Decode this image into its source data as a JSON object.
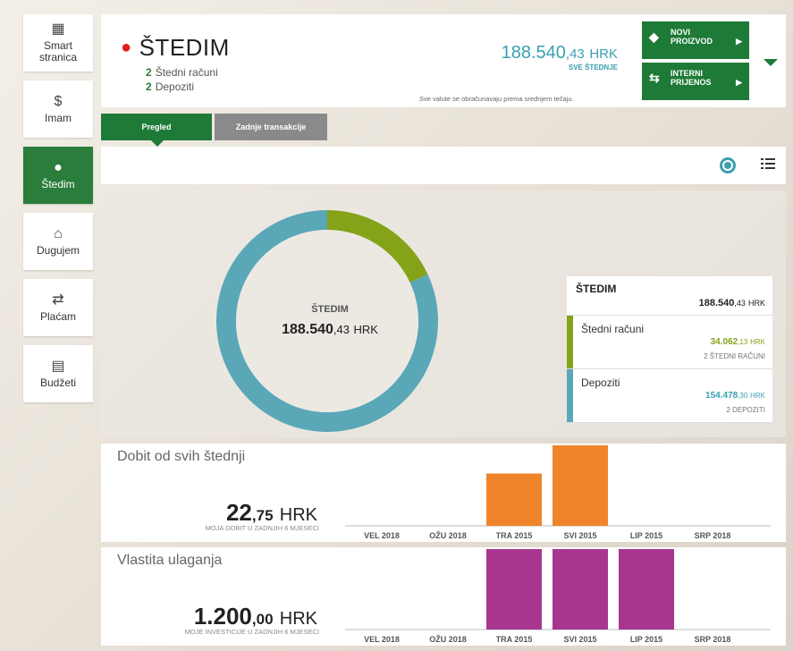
{
  "sidebar": {
    "items": [
      {
        "label": "Smart stranica",
        "icon": "grid-icon"
      },
      {
        "label": "Imam",
        "icon": "money-bag-icon"
      },
      {
        "label": "Štedim",
        "icon": "piggy-bank-icon"
      },
      {
        "label": "Dugujem",
        "icon": "house-debt-icon"
      },
      {
        "label": "Plaćam",
        "icon": "payment-icon"
      },
      {
        "label": "Budžeti",
        "icon": "wallet-icon"
      }
    ]
  },
  "header": {
    "title": "ŠTEDIM",
    "sub1_count": "2",
    "sub1_label": "Štedni računi",
    "sub2_count": "2",
    "sub2_label": "Depoziti",
    "total_int": "188.540",
    "total_dec": ",43",
    "total_cur": "HRK",
    "total_label": "SVE ŠTEDNJE",
    "note": "Sve valute se obračunavaju prema srednjem tečaju.",
    "btn_new_l1": "NOVI",
    "btn_new_l2": "PROIZVOD",
    "btn_transfer_l1": "INTERNI",
    "btn_transfer_l2": "PRIJENOS"
  },
  "tabs": {
    "overview": "Pregled",
    "transactions": "Zadnje transakcije"
  },
  "donut": {
    "center_label": "ŠTEDIM",
    "center_int": "188.540",
    "center_dec": ",43",
    "center_cur": "HRK"
  },
  "legend": {
    "title": "ŠTEDIM",
    "total_int": "188.540",
    "total_dec": ",43",
    "total_cur": "HRK",
    "rows": [
      {
        "name": "Štedni računi",
        "int": "34.062",
        "dec": ",13",
        "cur": "HRK",
        "sub": "2 ŠTEDNI RAČUNI",
        "color": "#84a318"
      },
      {
        "name": "Depoziti",
        "int": "154.478",
        "dec": ",30",
        "cur": "HRK",
        "sub": "2 DEPOZITI",
        "color": "#5aa7b8"
      }
    ]
  },
  "profit": {
    "title": "Dobit od svih štednji",
    "int": "22",
    "dec": ",75",
    "cur": "HRK",
    "sub": "MOJA DOBIT U ZADNJIH 6 MJESECI"
  },
  "investments": {
    "title": "Vlastita ulaganja",
    "int": "1.200",
    "dec": ",00",
    "cur": "HRK",
    "sub": "MOJE INVESTICIJE U ZADNJIH 6 MJESECI"
  },
  "chart_data": [
    {
      "type": "pie",
      "categories": [
        "Štedni računi",
        "Depoziti"
      ],
      "values": [
        34062.13,
        154478.3
      ],
      "colors": [
        "#84a318",
        "#5aa7b8"
      ]
    },
    {
      "type": "bar",
      "categories": [
        "VEL 2018",
        "OŽU 2018",
        "TRA 2015",
        "SVI 2015",
        "LIP 2015",
        "SRP 2018"
      ],
      "values": [
        0,
        0,
        6.5,
        10,
        0,
        0
      ],
      "color": "#f0842a"
    },
    {
      "type": "bar",
      "categories": [
        "VEL 2018",
        "OŽU 2018",
        "TRA 2015",
        "SVI 2015",
        "LIP 2015",
        "SRP 2018"
      ],
      "values": [
        0,
        0,
        400,
        400,
        400,
        0
      ],
      "color": "#a8368f"
    }
  ]
}
